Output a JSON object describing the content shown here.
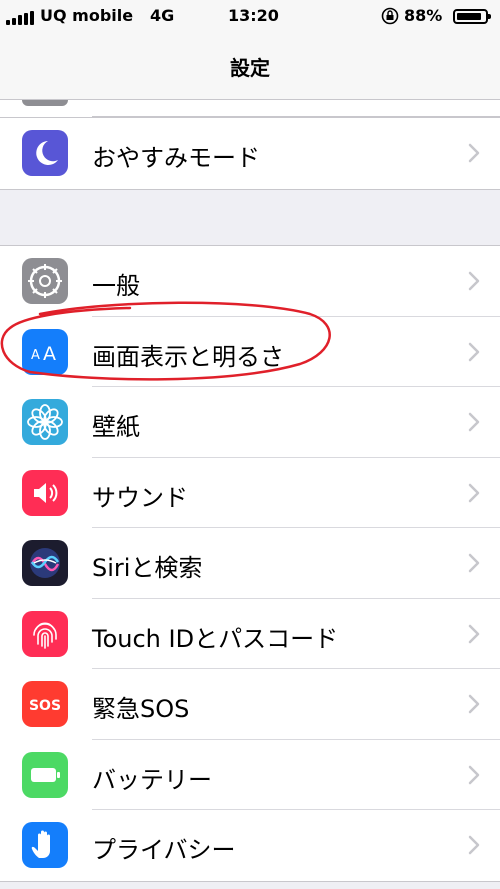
{
  "status_bar": {
    "carrier": "UQ mobile",
    "network": "4G",
    "time": "13:20",
    "battery_percent": "88%",
    "battery_level": 0.88
  },
  "nav": {
    "title": "設定"
  },
  "groups": [
    {
      "items": [
        {
          "label": "おやすみモード",
          "icon": "moon-icon",
          "color": "#5856d6"
        }
      ]
    },
    {
      "items": [
        {
          "label": "一般",
          "icon": "gear-icon",
          "color": "#8e8e93"
        },
        {
          "label": "画面表示と明るさ",
          "icon": "text-size-icon",
          "color": "#147efb"
        },
        {
          "label": "壁紙",
          "icon": "flower-icon",
          "color": "#34aadc"
        },
        {
          "label": "サウンド",
          "icon": "speaker-icon",
          "color": "#ff2d55"
        },
        {
          "label": "Siriと検索",
          "icon": "siri-icon",
          "color": "#1c1c2e"
        },
        {
          "label": "Touch IDとパスコード",
          "icon": "fingerprint-icon",
          "color": "#ff2d55"
        },
        {
          "label": "緊急SOS",
          "icon": "sos-icon",
          "icon_text": "SOS",
          "color": "#ff3b30"
        },
        {
          "label": "バッテリー",
          "icon": "battery-icon",
          "color": "#4cd964"
        },
        {
          "label": "プライバシー",
          "icon": "hand-icon",
          "color": "#147efb"
        }
      ]
    }
  ],
  "annotation": {
    "color": "#e0202a"
  }
}
